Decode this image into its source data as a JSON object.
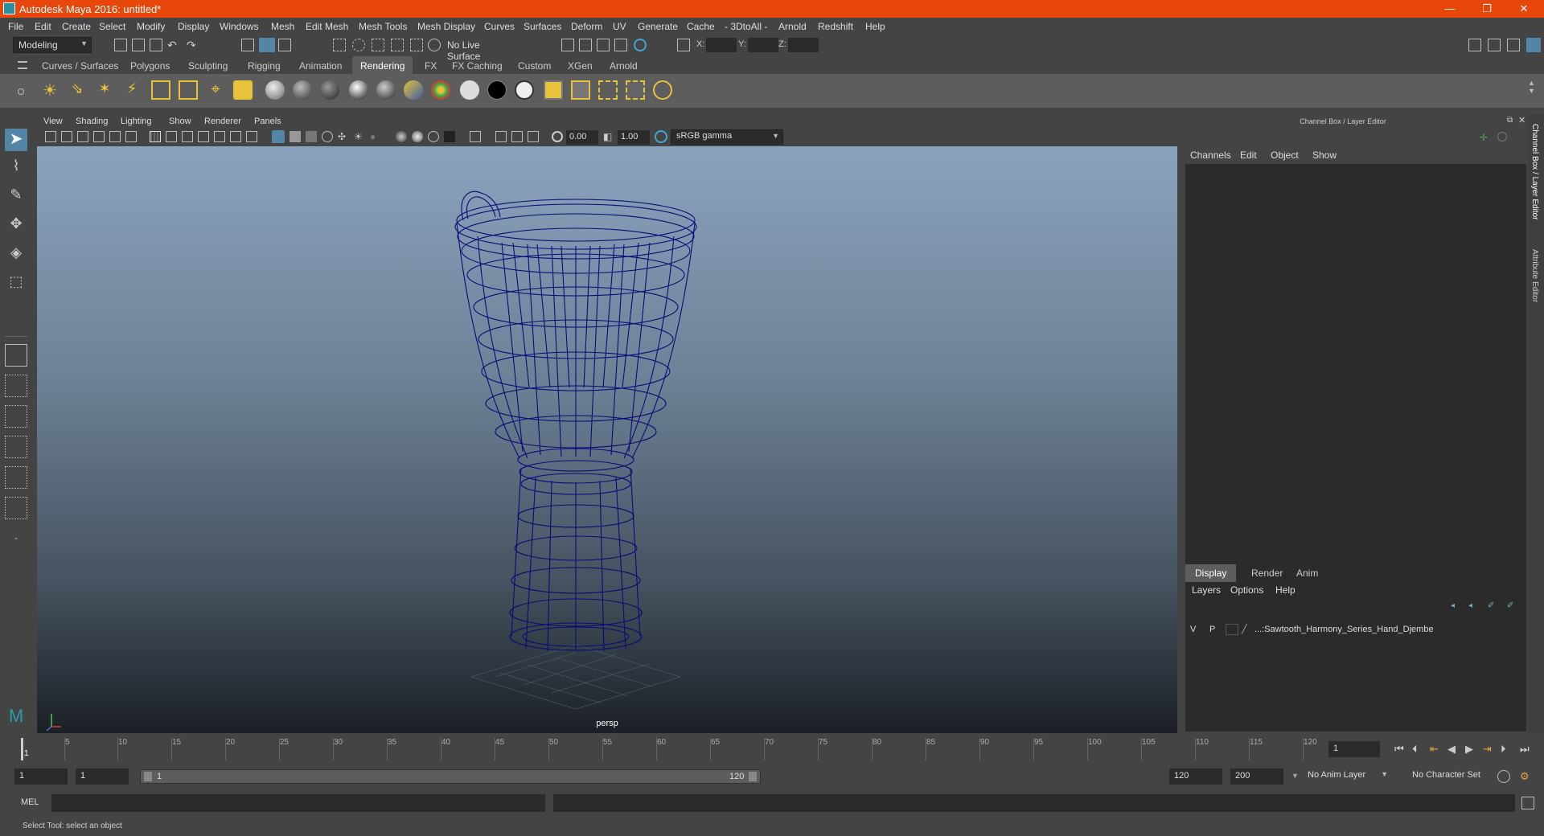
{
  "window": {
    "title": "Autodesk Maya 2016: untitled*",
    "controls": [
      "—",
      "❐",
      "✕"
    ]
  },
  "menubar": {
    "items": [
      "File",
      "Edit",
      "Create",
      "Select",
      "Modify",
      "Display",
      "Windows",
      "Mesh",
      "Edit Mesh",
      "Mesh Tools",
      "Mesh Display",
      "Curves",
      "Surfaces",
      "Deform",
      "UV",
      "Generate",
      "Cache",
      "- 3DtoAll -",
      "Arnold",
      "Redshift",
      "Help"
    ]
  },
  "statusline": {
    "mode": "Modeling",
    "live_surface": "No Live Surface",
    "x_label": "X:",
    "y_label": "Y:",
    "z_label": "Z:"
  },
  "shelf": {
    "tabs": [
      "Curves / Surfaces",
      "Polygons",
      "Sculpting",
      "Rigging",
      "Animation",
      "Rendering",
      "FX",
      "FX Caching",
      "Custom",
      "XGen",
      "Arnold"
    ],
    "active_tab": "Rendering"
  },
  "viewport": {
    "menus": [
      "View",
      "Shading",
      "Lighting",
      "Show",
      "Renderer",
      "Panels"
    ],
    "exposure": "0.00",
    "gamma": "1.00",
    "color_space": "sRGB gamma",
    "camera": "persp"
  },
  "channelbox": {
    "title": "Channel Box / Layer Editor",
    "menus": [
      "Channels",
      "Edit",
      "Object",
      "Show"
    ],
    "layer_tabs": [
      "Display",
      "Render",
      "Anim"
    ],
    "active_layer_tab": "Display",
    "layer_menus": [
      "Layers",
      "Options",
      "Help"
    ],
    "layer": {
      "v": "V",
      "p": "P",
      "name": "...:Sawtooth_Harmony_Series_Hand_Djembe"
    },
    "side_tabs": [
      "Channel Box / Layer Editor",
      "Attribute Editor"
    ]
  },
  "timeline": {
    "ticks": [
      "1",
      "5",
      "10",
      "15",
      "20",
      "25",
      "30",
      "35",
      "40",
      "45",
      "50",
      "55",
      "60",
      "65",
      "70",
      "75",
      "80",
      "85",
      "90",
      "95",
      "100",
      "105",
      "110",
      "115",
      "120"
    ],
    "current_frame": "1"
  },
  "range": {
    "start": "1",
    "start_inner": "1",
    "slider_start": "1",
    "slider_end": "120",
    "end_inner": "120",
    "end": "200",
    "anim_layer": "No Anim Layer",
    "character_set": "No Character Set"
  },
  "cmdline": {
    "label": "MEL"
  },
  "helpline": {
    "text": "Select Tool: select an object"
  },
  "colors": {
    "titlebar": "#e8470c",
    "accent": "#5285a6",
    "wireframe": "#0a0a78"
  }
}
